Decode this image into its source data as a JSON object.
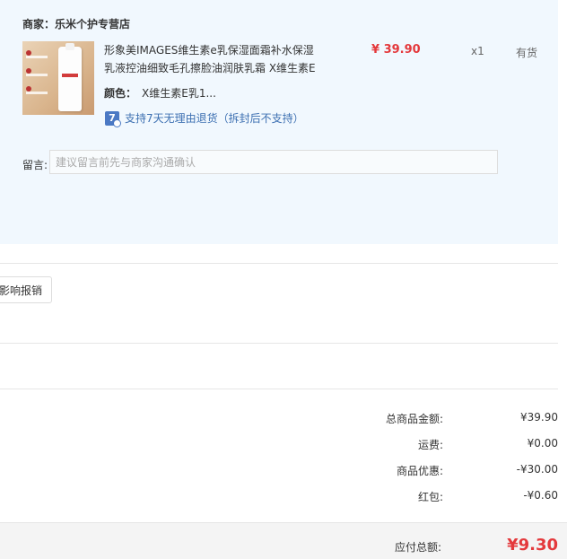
{
  "shop": {
    "label": "商家：",
    "name": "乐米个护专营店"
  },
  "product": {
    "title": "形象美IMAGES维生素e乳保湿面霜补水保湿乳液控油细致毛孔擦脸油润肤乳霜 X维生素E",
    "price": "¥ 39.90",
    "quantity": "x1",
    "stock": "有货",
    "color_label": "颜色：",
    "color_value": "X维生素E乳1...",
    "return_badge": "7",
    "return_policy": "支持7天无理由退货（拆封后不支持）"
  },
  "remark": {
    "label": "留言:",
    "placeholder": "建议留言前先与商家沟通确认"
  },
  "report_button": "影响报销",
  "summary": [
    {
      "label": "总商品金额:",
      "value": "¥39.90"
    },
    {
      "label": "运费:",
      "value": "¥0.00"
    },
    {
      "label": "商品优惠:",
      "value": "-¥30.00"
    },
    {
      "label": "红包:",
      "value": "-¥0.60"
    }
  ],
  "total": {
    "label": "应付总额:",
    "value": "¥9.30"
  },
  "colors": {
    "price_red": "#e4393c",
    "panel_bg": "#f1f8fe",
    "link_blue": "#3d70b2"
  }
}
